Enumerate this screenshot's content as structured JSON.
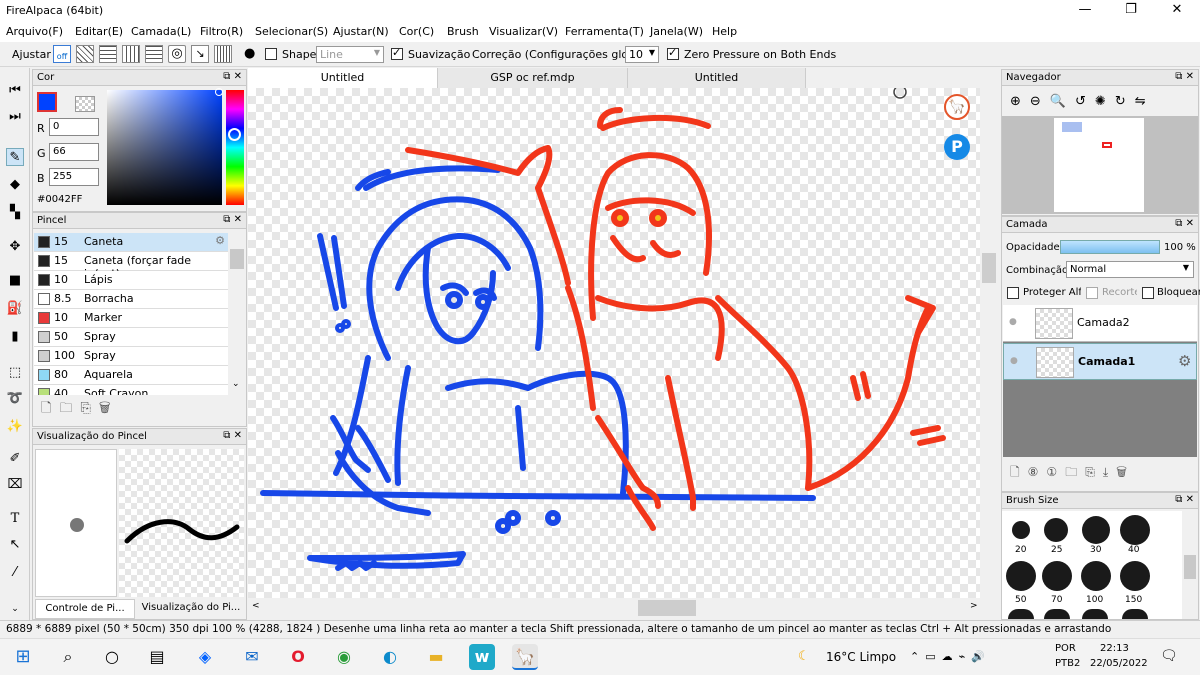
{
  "window": {
    "title": "FireAlpaca (64bit)"
  },
  "menu": [
    "Arquivo(F)",
    "Editar(E)",
    "Camada(L)",
    "Filtro(R)",
    "Selecionar(S)",
    "Ajustar(N)",
    "Cor(C)",
    "Brush",
    "Visualizar(V)",
    "Ferramenta(T)",
    "Janela(W)",
    "Help"
  ],
  "toolbar": {
    "ajustar_label": "Ajustar",
    "off_label": "off",
    "shape_label": "Shape",
    "shape_value": "Line",
    "suavizacao_label": "Suavização",
    "correcao_label": "Correção (Configurações globais)",
    "correcao_value": "10",
    "zero_pressure_label": "Zero Pressure on Both Ends"
  },
  "color_panel": {
    "title": "Cor",
    "r_label": "R",
    "r_value": "0",
    "g_label": "G",
    "g_value": "66",
    "b_label": "B",
    "b_value": "255",
    "hex": "#0042FF",
    "current_color": "#0042FF"
  },
  "brush_panel": {
    "title": "Pincel",
    "items": [
      {
        "size": "15",
        "name": "Caneta",
        "color": "#222222"
      },
      {
        "size": "15",
        "name": "Caneta (forçar fade in/out)",
        "color": "#222222"
      },
      {
        "size": "10",
        "name": "Lápis",
        "color": "#222222"
      },
      {
        "size": "8.5",
        "name": "Borracha",
        "color": "#ffffff"
      },
      {
        "size": "10",
        "name": "Marker",
        "color": "#e83a3a"
      },
      {
        "size": "50",
        "name": "Spray",
        "color": "#cfcfcf"
      },
      {
        "size": "100",
        "name": "Spray",
        "color": "#cfcfcf"
      },
      {
        "size": "80",
        "name": "Aquarela",
        "color": "#8fd8f5"
      },
      {
        "size": "40",
        "name": "Soft Crayon",
        "color": "#b8e07a"
      }
    ]
  },
  "preview_panel": {
    "title": "Visualização do Pincel",
    "tab1": "Controle de Pi...",
    "tab2": "Visualização do Pi..."
  },
  "tabs": [
    "Untitled",
    "GSP oc ref.mdp",
    "Untitled"
  ],
  "navigator": {
    "title": "Navegador"
  },
  "layer_panel": {
    "title": "Camada",
    "opacity_label": "Opacidade",
    "opacity_value": "100 %",
    "opacity_fraction": 1.0,
    "combine_label": "Combinação",
    "combine_value": "Normal",
    "protect_label": "Proteger Alfa",
    "clip_label": "Recorte",
    "lock_label": "Bloquear",
    "layers": [
      {
        "name": "Camada2"
      },
      {
        "name": "Camada1"
      }
    ]
  },
  "brush_size": {
    "title": "Brush Size",
    "sizes": [
      "20",
      "25",
      "30",
      "40",
      "50",
      "70",
      "100",
      "150"
    ]
  },
  "status": {
    "text": "6889 * 6889 pixel   (50 * 50cm)   350 dpi   100 %   (4288, 1824 )   Desenhe uma linha reta ao manter a tecla Shift pressionada, altere o tamanho de um pincel ao manter as teclas Ctrl + Alt pressionadas e arrastando"
  },
  "taskbar": {
    "weather": "16°C  Limpo",
    "lang1": "POR",
    "lang2": "PTB2",
    "time": "22:13",
    "date": "22/05/2022"
  },
  "colors": {
    "blue_stroke": "#1747E8",
    "red_stroke": "#F2361A"
  }
}
